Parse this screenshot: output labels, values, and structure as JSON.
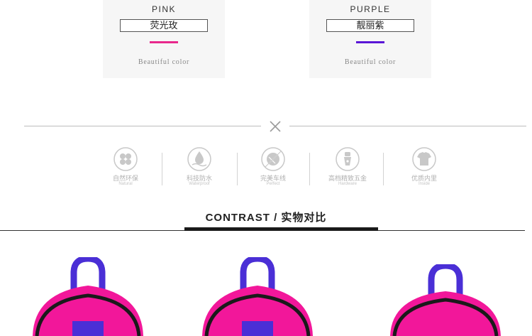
{
  "colors": [
    {
      "en": "PINK",
      "cn": "荧光玫",
      "sub": "Beautiful color",
      "bar_color": "#e8288c"
    },
    {
      "en": "PURPLE",
      "cn": "靓丽紫",
      "sub": "Beautiful color",
      "bar_color": "#5a16d6"
    }
  ],
  "features": [
    {
      "cn": "自然环保",
      "en": "Natural",
      "icon": "clover-icon"
    },
    {
      "cn": "科技防水",
      "en": "Waterproof",
      "icon": "water-drop-icon"
    },
    {
      "cn": "完美车线",
      "en": "Perfect",
      "icon": "thread-ball-icon"
    },
    {
      "cn": "高档精致五金",
      "en": "Hardware",
      "icon": "zipper-pull-icon"
    },
    {
      "cn": "优质内里",
      "en": "Inside",
      "icon": "shirt-icon"
    }
  ],
  "contrast": {
    "title": "CONTRAST / 实物对比"
  },
  "palette": {
    "pink": "#f2179a",
    "purple": "#4a2fd6",
    "dark": "#1a1a1a"
  }
}
